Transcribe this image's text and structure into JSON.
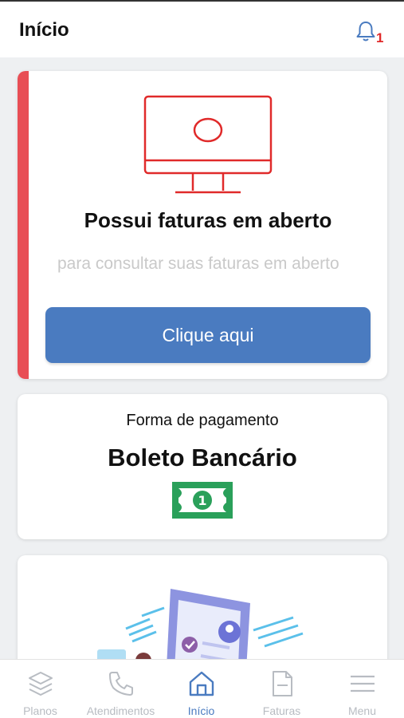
{
  "header": {
    "title": "Início",
    "notification_count": "1"
  },
  "invoice_card": {
    "headline": "Possui faturas em aberto",
    "subtitle": "para consultar suas faturas em aberto",
    "button_label": "Clique aqui",
    "accent_color": "#e84e55"
  },
  "payment_card": {
    "label": "Forma de pagamento",
    "value": "Boleto Bancário",
    "icon": "money-bill-icon"
  },
  "bottom_nav": {
    "items": [
      {
        "label": "Planos",
        "icon": "layers-icon"
      },
      {
        "label": "Atendimentos",
        "icon": "phone-icon"
      },
      {
        "label": "Início",
        "icon": "home-icon"
      },
      {
        "label": "Faturas",
        "icon": "invoice-icon"
      },
      {
        "label": "Menu",
        "icon": "hamburger-icon"
      }
    ],
    "active_index": 2,
    "active_color": "#4a7bc0"
  }
}
